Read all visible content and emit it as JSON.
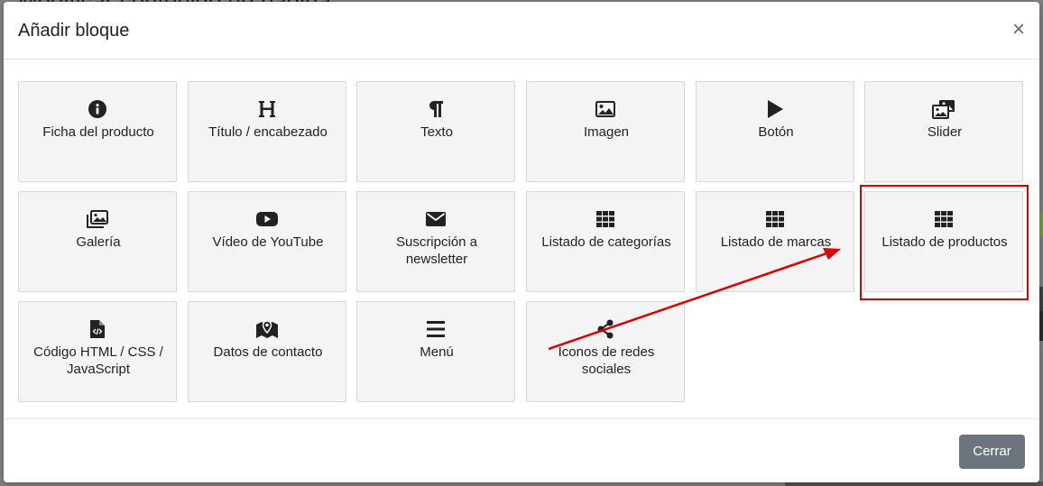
{
  "background": {
    "page_title": "Modificar contenido de página"
  },
  "modal": {
    "title": "Añadir bloque",
    "close_symbol": "×",
    "footer_close_label": "Cerrar",
    "blocks": [
      {
        "label": "Ficha del producto",
        "icon": "info-circle-icon"
      },
      {
        "label": "Título / encabezado",
        "icon": "heading-icon"
      },
      {
        "label": "Texto",
        "icon": "paragraph-icon"
      },
      {
        "label": "Imagen",
        "icon": "image-icon"
      },
      {
        "label": "Botón",
        "icon": "play-icon"
      },
      {
        "label": "Slider",
        "icon": "images-stack-icon"
      },
      {
        "label": "Galería",
        "icon": "gallery-icon"
      },
      {
        "label": "Vídeo de YouTube",
        "icon": "youtube-icon"
      },
      {
        "label": "Suscripción a newsletter",
        "icon": "envelope-icon"
      },
      {
        "label": "Listado de categorías",
        "icon": "grid-icon"
      },
      {
        "label": "Listado de marcas",
        "icon": "grid-icon"
      },
      {
        "label": "Listado de productos",
        "icon": "grid-icon"
      },
      {
        "label": "Código HTML / CSS / JavaScript",
        "icon": "code-file-icon"
      },
      {
        "label": "Datos de contacto",
        "icon": "map-marker-icon"
      },
      {
        "label": "Menú",
        "icon": "bars-icon"
      },
      {
        "label": "Iconos de redes sociales",
        "icon": "share-icon"
      }
    ]
  },
  "colors": {
    "tile_bg": "#f4f4f4",
    "highlight": "#e00000",
    "footer_button": "#6c757d"
  }
}
